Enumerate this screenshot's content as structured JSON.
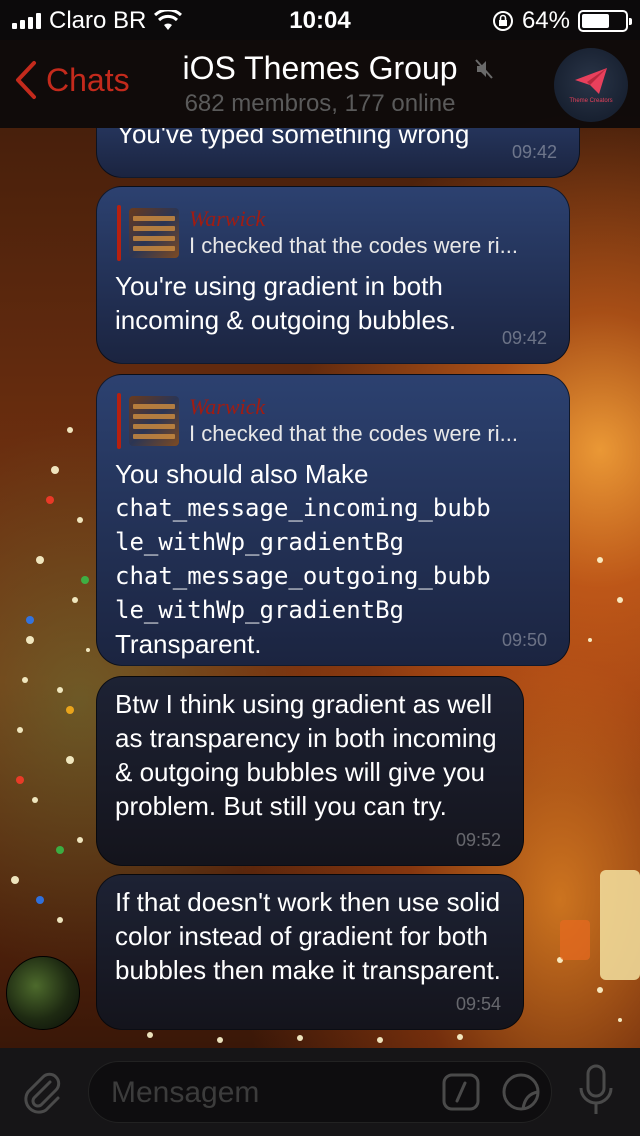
{
  "status_bar": {
    "carrier": "Claro BR",
    "time": "10:04",
    "battery_percent": "64%",
    "battery_level": 0.64
  },
  "nav": {
    "back_label": "Chats",
    "title": "iOS Themes Group",
    "subtitle": "682 membros, 177 online",
    "avatar_caption": "Theme Creators"
  },
  "messages": [
    {
      "text": "You've typed something wrong",
      "time": "09:42"
    },
    {
      "reply_name": "Warwick",
      "reply_quote": "I checked that the codes were ri...",
      "text": "You're using gradient in both incoming & outgoing bubbles.",
      "time": "09:42"
    },
    {
      "reply_name": "Warwick",
      "reply_quote": "I checked that the codes were ri...",
      "text_line1": "You should also Make",
      "code_line1": "chat_message_incoming_bubb",
      "code_line2": "le_withWp_gradientBg",
      "code_line3": "chat_message_outgoing_bubb",
      "code_line4": "le_withWp_gradientBg",
      "text_line2": "Transparent.",
      "time": "09:50"
    },
    {
      "text": "Btw I think using gradient as well as transparency in both incoming & outgoing bubbles will give you problem. But still you can try.",
      "time": "09:52"
    },
    {
      "text": "If that doesn't work then use solid color instead of gradient for both bubbles then make it transparent.",
      "time": "09:54"
    }
  ],
  "input": {
    "placeholder": "Mensagem"
  },
  "colors": {
    "accent": "#c42a1c",
    "reply_name": "#a01c12",
    "bubble_top": "#2c4170",
    "bubble_bottom": "#1b2440"
  }
}
